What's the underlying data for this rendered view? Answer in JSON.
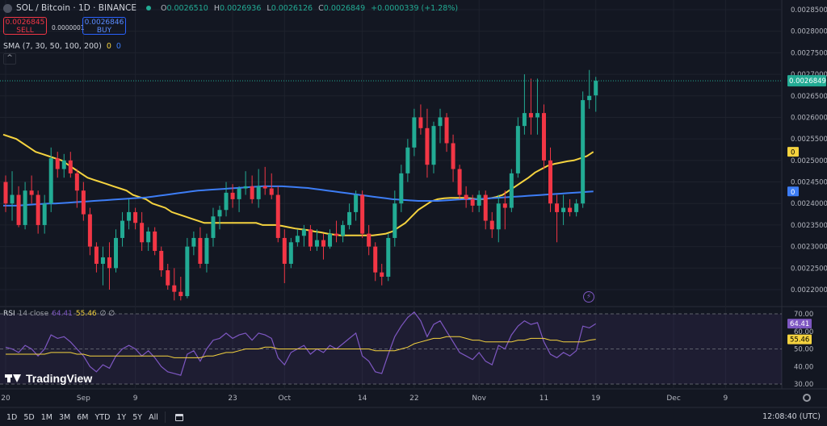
{
  "header": {
    "title": "SOL / Bitcoin · 1D · BINANCE",
    "o_label": "O",
    "o": "0.0026510",
    "h_label": "H",
    "h": "0.0026936",
    "l_label": "L",
    "l": "0.0026126",
    "c_label": "C",
    "c": "0.0026849",
    "change": "+0.0000339 (+1.28%)"
  },
  "trade": {
    "sell_price": "0.0026845",
    "sell_label": "SELL",
    "spread": "0.0000001",
    "buy_price": "0.0026846",
    "buy_label": "BUY"
  },
  "sma_legend": {
    "label": "SMA (7, 30, 50, 100, 200)",
    "v1": "0",
    "v2": "0"
  },
  "rsi_legend": {
    "label": "RSI",
    "params": "14 close",
    "v1": "64.41",
    "v2": "55.46",
    "v3": "∅ ∅"
  },
  "brand": "TradingView",
  "bottom": {
    "timeframes": [
      "1D",
      "5D",
      "1M",
      "3M",
      "6M",
      "YTD",
      "1Y",
      "5Y",
      "All"
    ],
    "clock": "12:08:40 (UTC)"
  },
  "colors": {
    "up": "#22ab94",
    "down": "#f23645",
    "sma_yellow": "#f5d33f",
    "sma_blue": "#3d7df5",
    "rsi": "#7e57c2",
    "rsi_ma": "#f5d33f",
    "bg": "#131722",
    "grid": "#1e222d"
  },
  "chart_data": {
    "type": "candlestick",
    "title": "SOL / Bitcoin · 1D · BINANCE",
    "price_axis": {
      "min": 0.0022,
      "max": 0.00285,
      "ticks": [
        "0.0028500",
        "0.0028000",
        "0.0027500",
        "0.0027000",
        "0.0026500",
        "0.0026000",
        "0.0025500",
        "0.0025000",
        "0.0024500",
        "0.0024000",
        "0.0023500",
        "0.0023000",
        "0.0022500",
        "0.0022000"
      ],
      "last_price": "0.0026849",
      "sma_yellow_badge": "0",
      "sma_blue_badge": "0"
    },
    "time_axis": {
      "labels": [
        "20",
        "Sep",
        "9",
        "23",
        "Oct",
        "14",
        "22",
        "Nov",
        "11",
        "19",
        "Dec",
        "9"
      ],
      "label_day_index": [
        0,
        12,
        20,
        35,
        43,
        55,
        63,
        73,
        83,
        91,
        103,
        111
      ]
    },
    "candles": [
      [
        0.00245,
        0.002465,
        0.00238,
        0.0024
      ],
      [
        0.0024,
        0.002475,
        0.00236,
        0.00242
      ],
      [
        0.00242,
        0.00244,
        0.002345,
        0.00235
      ],
      [
        0.00235,
        0.00245,
        0.00234,
        0.00243
      ],
      [
        0.00243,
        0.002465,
        0.0024,
        0.00242
      ],
      [
        0.00242,
        0.00243,
        0.00233,
        0.00235
      ],
      [
        0.00235,
        0.00242,
        0.00233,
        0.0024
      ],
      [
        0.0024,
        0.00253,
        0.00238,
        0.002505
      ],
      [
        0.002505,
        0.00252,
        0.00246,
        0.00248
      ],
      [
        0.00248,
        0.002515,
        0.00246,
        0.0025
      ],
      [
        0.0025,
        0.00252,
        0.00246,
        0.00247
      ],
      [
        0.00247,
        0.00248,
        0.00239,
        0.00243
      ],
      [
        0.00243,
        0.00245,
        0.00236,
        0.002375
      ],
      [
        0.002375,
        0.00239,
        0.00228,
        0.0023
      ],
      [
        0.0023,
        0.00231,
        0.00224,
        0.00226
      ],
      [
        0.00226,
        0.0023,
        0.00221,
        0.002275
      ],
      [
        0.002275,
        0.00231,
        0.0022,
        0.00225
      ],
      [
        0.00225,
        0.00234,
        0.00224,
        0.00232
      ],
      [
        0.00232,
        0.00238,
        0.0023,
        0.00236
      ],
      [
        0.00236,
        0.00241,
        0.00234,
        0.00238
      ],
      [
        0.00238,
        0.00239,
        0.00234,
        0.002355
      ],
      [
        0.002355,
        0.00238,
        0.00229,
        0.00231
      ],
      [
        0.00231,
        0.002345,
        0.00229,
        0.002335
      ],
      [
        0.002335,
        0.002345,
        0.00228,
        0.00229
      ],
      [
        0.00229,
        0.0023,
        0.00223,
        0.002245
      ],
      [
        0.002245,
        0.00226,
        0.0022,
        0.00221
      ],
      [
        0.00221,
        0.00225,
        0.002175,
        0.002195
      ],
      [
        0.002195,
        0.00223,
        0.002175,
        0.002185
      ],
      [
        0.002185,
        0.00232,
        0.00218,
        0.0023
      ],
      [
        0.0023,
        0.002335,
        0.00228,
        0.00232
      ],
      [
        0.00232,
        0.002345,
        0.00225,
        0.00226
      ],
      [
        0.00226,
        0.00233,
        0.00224,
        0.00232
      ],
      [
        0.00232,
        0.00239,
        0.0023,
        0.00237
      ],
      [
        0.00237,
        0.002395,
        0.00234,
        0.002385
      ],
      [
        0.002385,
        0.00245,
        0.00237,
        0.002425
      ],
      [
        0.002425,
        0.002445,
        0.00239,
        0.00241
      ],
      [
        0.00241,
        0.00244,
        0.00238,
        0.002435
      ],
      [
        0.002435,
        0.002475,
        0.00242,
        0.00244
      ],
      [
        0.00244,
        0.002465,
        0.0024,
        0.00241
      ],
      [
        0.00241,
        0.00248,
        0.00239,
        0.00244
      ],
      [
        0.00244,
        0.002485,
        0.00242,
        0.002435
      ],
      [
        0.002435,
        0.00247,
        0.00241,
        0.00242
      ],
      [
        0.00242,
        0.00244,
        0.00231,
        0.00232
      ],
      [
        0.00232,
        0.00234,
        0.002215,
        0.00226
      ],
      [
        0.00226,
        0.00232,
        0.00225,
        0.00231
      ],
      [
        0.00231,
        0.00234,
        0.0023,
        0.002325
      ],
      [
        0.002325,
        0.00235,
        0.0023,
        0.00234
      ],
      [
        0.00234,
        0.00235,
        0.00229,
        0.0023
      ],
      [
        0.0023,
        0.00234,
        0.00229,
        0.002315
      ],
      [
        0.002315,
        0.00233,
        0.00227,
        0.0023
      ],
      [
        0.0023,
        0.00234,
        0.002295,
        0.00233
      ],
      [
        0.00233,
        0.00236,
        0.00231,
        0.002325
      ],
      [
        0.002325,
        0.00236,
        0.00231,
        0.00235
      ],
      [
        0.00235,
        0.0024,
        0.00234,
        0.00238
      ],
      [
        0.00238,
        0.00243,
        0.00236,
        0.00242
      ],
      [
        0.00242,
        0.00243,
        0.00232,
        0.00233
      ],
      [
        0.00233,
        0.00235,
        0.00228,
        0.0023
      ],
      [
        0.0023,
        0.00231,
        0.00222,
        0.00224
      ],
      [
        0.00224,
        0.00226,
        0.00221,
        0.00223
      ],
      [
        0.00223,
        0.00233,
        0.00222,
        0.00232
      ],
      [
        0.00232,
        0.00243,
        0.0023,
        0.0024
      ],
      [
        0.0024,
        0.00249,
        0.00238,
        0.00247
      ],
      [
        0.00247,
        0.00255,
        0.00245,
        0.00253
      ],
      [
        0.00253,
        0.00262,
        0.00251,
        0.0026
      ],
      [
        0.0026,
        0.00263,
        0.00256,
        0.002575
      ],
      [
        0.002575,
        0.00262,
        0.00246,
        0.00249
      ],
      [
        0.00249,
        0.00259,
        0.00247,
        0.00258
      ],
      [
        0.00258,
        0.00262,
        0.00254,
        0.0026
      ],
      [
        0.0026,
        0.00261,
        0.00252,
        0.00254
      ],
      [
        0.00254,
        0.00256,
        0.00245,
        0.00248
      ],
      [
        0.00248,
        0.00249,
        0.00241,
        0.00242
      ],
      [
        0.00242,
        0.00244,
        0.00239,
        0.00241
      ],
      [
        0.00241,
        0.00242,
        0.00238,
        0.002395
      ],
      [
        0.002395,
        0.00243,
        0.00238,
        0.00242
      ],
      [
        0.00242,
        0.00243,
        0.00234,
        0.00236
      ],
      [
        0.00236,
        0.00238,
        0.00232,
        0.00234
      ],
      [
        0.00234,
        0.00242,
        0.00231,
        0.0024
      ],
      [
        0.0024,
        0.00243,
        0.00234,
        0.00239
      ],
      [
        0.00239,
        0.00248,
        0.00238,
        0.00247
      ],
      [
        0.00247,
        0.0026,
        0.00246,
        0.00258
      ],
      [
        0.00258,
        0.0027,
        0.00256,
        0.00261
      ],
      [
        0.00261,
        0.00269,
        0.00256,
        0.0026
      ],
      [
        0.0026,
        0.00269,
        0.00256,
        0.00261
      ],
      [
        0.00261,
        0.00263,
        0.00248,
        0.0025
      ],
      [
        0.0025,
        0.00253,
        0.00238,
        0.0024
      ],
      [
        0.0024,
        0.00242,
        0.00231,
        0.00238
      ],
      [
        0.00238,
        0.00242,
        0.00235,
        0.00239
      ],
      [
        0.00239,
        0.00241,
        0.00237,
        0.00238
      ],
      [
        0.00238,
        0.00241,
        0.00237,
        0.0024
      ],
      [
        0.0024,
        0.00266,
        0.00239,
        0.00264
      ],
      [
        0.00264,
        0.00271,
        0.00262,
        0.00265
      ],
      [
        0.002651,
        0.002694,
        0.002613,
        0.002685
      ]
    ],
    "series": [
      {
        "name": "SMA",
        "values": [
          0.00256,
          0.002555,
          0.00255,
          0.00254,
          0.00253,
          0.00252,
          0.002515,
          0.00251,
          0.002505,
          0.0025,
          0.00249,
          0.00248,
          0.00247,
          0.00246,
          0.002455,
          0.00245,
          0.002445,
          0.00244,
          0.002435,
          0.00243,
          0.00242,
          0.002415,
          0.00241,
          0.0024,
          0.002395,
          0.00239,
          0.00238,
          0.002375,
          0.00237,
          0.002365,
          0.00236,
          0.002355,
          0.002355,
          0.002355,
          0.002355,
          0.002355,
          0.002355,
          0.002355,
          0.002355,
          0.002355,
          0.00235,
          0.00235,
          0.00235,
          0.002348,
          0.002345,
          0.002342,
          0.00234,
          0.002338,
          0.002335,
          0.002333,
          0.00233,
          0.002328,
          0.002326,
          0.002326,
          0.002326,
          0.002326,
          0.002326,
          0.002326,
          0.002328,
          0.00233,
          0.002335,
          0.002345,
          0.002355,
          0.00237,
          0.002385,
          0.002395,
          0.002405,
          0.00241,
          0.002412,
          0.002413,
          0.002413,
          0.002413,
          0.002412,
          0.00241,
          0.00241,
          0.002412,
          0.002415,
          0.00242,
          0.00243,
          0.00244,
          0.00245,
          0.00246,
          0.002472,
          0.00248,
          0.002488,
          0.002492,
          0.002495,
          0.002498,
          0.0025,
          0.002505,
          0.00251,
          0.00252
        ]
      },
      {
        "name": "SMA",
        "values": [
          0.002395,
          0.002395,
          0.002395,
          0.002396,
          0.002397,
          0.002398,
          0.002399,
          0.0024,
          0.0024,
          0.002401,
          0.002402,
          0.002403,
          0.002404,
          0.002405,
          0.002406,
          0.002407,
          0.002408,
          0.002409,
          0.00241,
          0.002411,
          0.002412,
          0.002413,
          0.002414,
          0.002416,
          0.002418,
          0.00242,
          0.002422,
          0.002424,
          0.002426,
          0.002428,
          0.00243,
          0.002431,
          0.002432,
          0.002433,
          0.002434,
          0.002435,
          0.002436,
          0.002437,
          0.002438,
          0.002439,
          0.00244,
          0.00244,
          0.00244,
          0.00244,
          0.002439,
          0.002438,
          0.002437,
          0.002436,
          0.002434,
          0.002432,
          0.00243,
          0.002428,
          0.002426,
          0.002424,
          0.002422,
          0.00242,
          0.002418,
          0.002416,
          0.002414,
          0.002412,
          0.00241,
          0.002409,
          0.002408,
          0.002407,
          0.002406,
          0.002406,
          0.002406,
          0.002406,
          0.002407,
          0.002408,
          0.002409,
          0.00241,
          0.00241,
          0.00241,
          0.002411,
          0.002412,
          0.002413,
          0.002414,
          0.002415,
          0.002416,
          0.002417,
          0.002418,
          0.002419,
          0.00242,
          0.002421,
          0.002422,
          0.002423,
          0.002424,
          0.002425,
          0.002426,
          0.002427,
          0.002428
        ]
      }
    ],
    "rsi": {
      "axis": {
        "min": 30,
        "max": 70,
        "ticks": [
          "70.00",
          "60.00",
          "50.00",
          "40.00",
          "30.00"
        ]
      },
      "levels": [
        70,
        50,
        30
      ],
      "values": [
        51,
        50,
        48,
        52,
        50,
        46,
        50,
        58,
        56,
        57,
        54,
        50,
        46,
        40,
        37,
        41,
        39,
        46,
        50,
        52,
        50,
        46,
        49,
        45,
        40,
        37,
        36,
        35,
        47,
        49,
        43,
        50,
        55,
        56,
        59,
        56,
        58,
        59,
        55,
        59,
        58,
        56,
        45,
        41,
        48,
        50,
        52,
        47,
        50,
        48,
        52,
        50,
        53,
        56,
        59,
        46,
        43,
        37,
        36,
        47,
        57,
        63,
        68,
        71,
        66,
        57,
        64,
        66,
        60,
        54,
        48,
        46,
        44,
        48,
        43,
        41,
        52,
        50,
        58,
        63,
        66,
        64,
        65,
        54,
        47,
        45,
        48,
        46,
        49,
        63,
        62,
        64.41
      ],
      "ma_values": [
        47,
        47,
        47,
        47,
        47,
        47,
        47,
        48,
        48,
        48,
        48,
        47,
        47,
        46,
        46,
        46,
        46,
        46,
        46,
        46,
        46,
        46,
        46,
        46,
        46,
        46,
        45,
        45,
        45,
        45,
        45,
        46,
        46,
        47,
        48,
        48,
        49,
        50,
        50,
        50,
        51,
        51,
        50,
        50,
        50,
        50,
        50,
        50,
        50,
        50,
        50,
        50,
        50,
        50,
        50,
        50,
        50,
        49,
        49,
        49,
        49,
        50,
        51,
        53,
        54,
        55,
        56,
        56,
        57,
        57,
        57,
        56,
        55,
        55,
        54,
        54,
        54,
        54,
        54,
        55,
        55,
        56,
        56,
        56,
        55,
        55,
        54,
        54,
        54,
        54,
        55,
        55.46
      ],
      "value_badge": "64.41",
      "ma_badge": "55.46"
    }
  }
}
